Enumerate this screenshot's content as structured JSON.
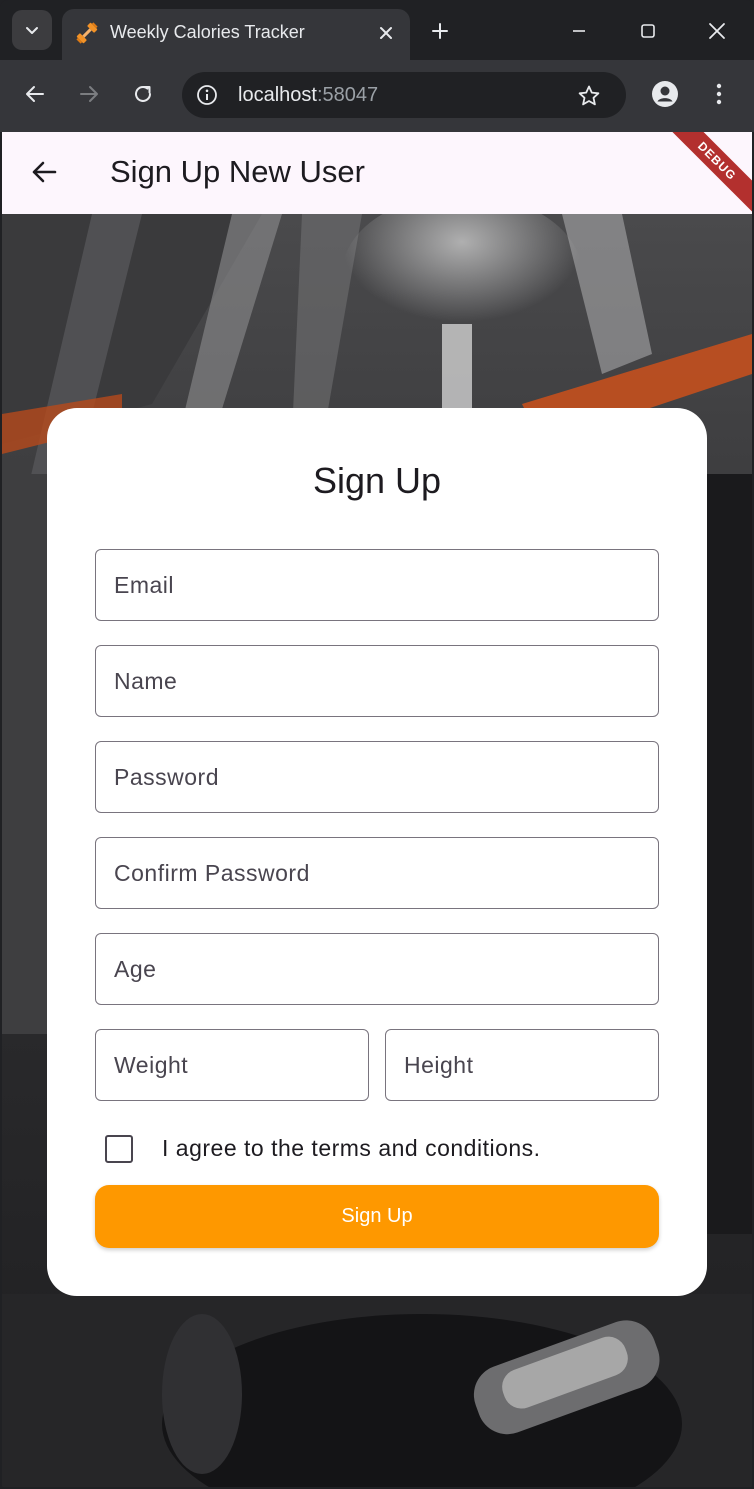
{
  "browser": {
    "tab_title": "Weekly Calories Tracker",
    "url_host": "localhost",
    "url_port": ":58047",
    "icons": {
      "tab_search": "chevron-down-icon",
      "favicon": "dumbbell-icon",
      "tab_close": "close-icon",
      "new_tab": "plus-icon",
      "minimize": "minimize-icon",
      "maximize": "maximize-icon",
      "close_window": "close-icon",
      "back": "arrow-left-icon",
      "forward": "arrow-right-icon",
      "reload": "reload-icon",
      "site_info": "info-icon",
      "bookmark": "star-icon",
      "profile": "person-icon",
      "menu": "kebab-menu-icon"
    }
  },
  "app": {
    "title": "Sign Up New User",
    "debug_label": "DEBUG",
    "card": {
      "title": "Sign Up",
      "fields": {
        "email": "Email",
        "name": "Name",
        "password": "Password",
        "confirm_password": "Confirm Password",
        "age": "Age",
        "weight": "Weight",
        "height": "Height"
      },
      "terms_label": "I agree to the terms and conditions.",
      "terms_checked": false,
      "submit_label": "Sign Up"
    }
  },
  "colors": {
    "accent": "#fe9800",
    "appbar_bg": "#fdf6fd",
    "debug_banner": "#b3302e",
    "browser_dark": "#202124",
    "browser_toolbar": "#35363a"
  }
}
